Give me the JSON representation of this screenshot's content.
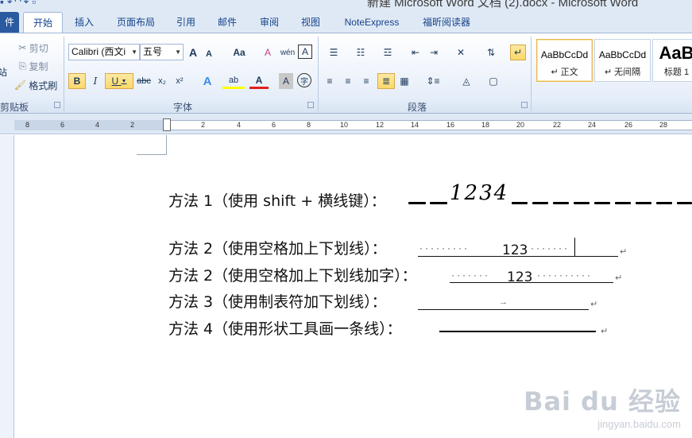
{
  "window": {
    "title": "新建 Microsoft Word 文档 (2).docx - Microsoft Word"
  },
  "tabs": [
    "件",
    "开始",
    "插入",
    "页面布局",
    "引用",
    "邮件",
    "审阅",
    "视图",
    "NoteExpress",
    "福昕阅读器"
  ],
  "clipboard": {
    "paste_label": "站",
    "cut": "剪切",
    "copy": "复制",
    "format_painter": "格式刷",
    "group": "剪贴板"
  },
  "font": {
    "name": "Calibri (西文i",
    "size": "五号",
    "grow": "A",
    "shrink": "A",
    "case": "Aa",
    "clear": "A",
    "phonetic": "wén",
    "border_char": "A",
    "bold": "B",
    "italic": "I",
    "underline": "U",
    "strike": "abc",
    "sub": "x₂",
    "sup": "x²",
    "effects": "A",
    "highlight": "ab",
    "color": "A",
    "shading": "A",
    "enclose": "字",
    "group": "字体"
  },
  "paragraph": {
    "group": "段落"
  },
  "styles": [
    {
      "sample": "AaBbCcDd",
      "name": "↵ 正文",
      "active": true
    },
    {
      "sample": "AaBbCcDd",
      "name": "↵ 无间隔",
      "active": false
    },
    {
      "sample": "AaB",
      "name": "标题 1",
      "active": false
    }
  ],
  "ruler": {
    "marks": [
      "8",
      "6",
      "4",
      "2",
      "2",
      "4",
      "6",
      "8",
      "10",
      "12",
      "14",
      "16",
      "18",
      "20",
      "22",
      "24",
      "26",
      "28"
    ]
  },
  "doc": {
    "line1": "方法 1（使用 shift + 横线键）：",
    "line1_hand": "1234",
    "line2": "方法 2（使用空格加上下划线）：",
    "line2_text": "123",
    "line3": "方法 2（使用空格加上下划线加字）：",
    "line3_text": "123",
    "line4": "方法 3（使用制表符加下划线）：",
    "line4_tab": "→",
    "line5": "方法 4（使用形状工具画一条线）：",
    "para_mark": "↵",
    "dots_a": "·········",
    "dots_b": "·······",
    "dots_c": "·······",
    "dots_d": "··········"
  },
  "watermark": {
    "brand": "Bai du 经验",
    "url": "jingyan.baidu.com"
  },
  "colors": {
    "accent": "#2a5aa0",
    "highlight": "#fbd869",
    "ribbon": "#dfe9f5",
    "font_red": "#e02020",
    "highlight_yellow": "#ffff00"
  }
}
